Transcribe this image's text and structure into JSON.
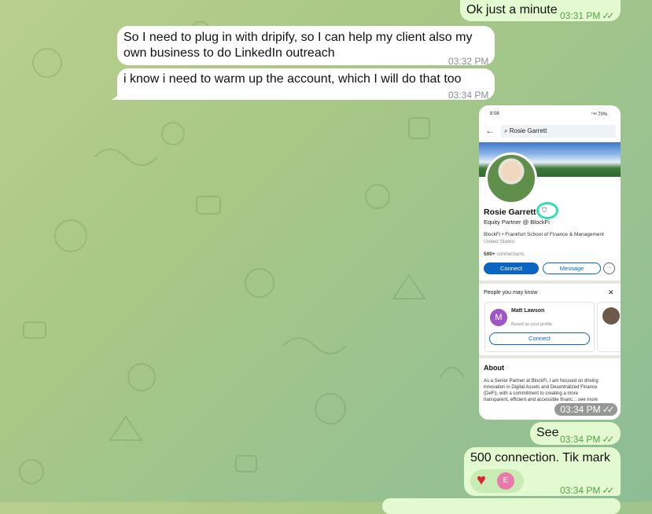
{
  "messages": [
    {
      "text": "Ok just a minute",
      "time": "03:31 PM",
      "ticks": "✓✓"
    },
    {
      "text_line1": "So I need to plug in with dripify, so I can help my client also my",
      "text_line2": "own business to do LinkedIn outreach",
      "time": "03:32 PM"
    },
    {
      "text": "i know i need to warm up the account, which I will do that too",
      "time": "03:34 PM"
    },
    {
      "image_time": "03:34 PM",
      "ticks": "✓✓"
    },
    {
      "text": "See",
      "time": "03:34 PM",
      "ticks": "✓✓"
    },
    {
      "text": "500 connection.  Tik mark",
      "time": "03:34 PM",
      "ticks": "✓✓",
      "reaction_emoji": "♥",
      "reaction_user": "E"
    }
  ],
  "screenshot": {
    "status_time": "8:08",
    "status_right": "⁺ᵃᵃ 70%",
    "search_value": "Rosie Garrett",
    "name": "Rosie Garrett",
    "headline": "Equity Partner @ BlockFi",
    "education": "BlockFi • Frankfurt School of Finance & Management",
    "location": "United States",
    "connections_count": "500+",
    "connections_label": "connections",
    "connect_label": "Connect",
    "message_label": "Message",
    "more_label": "···",
    "pymk_title": "People you may know",
    "pymk_close": "✕",
    "pymk_name": "Matt Lawson",
    "pymk_initial": "M",
    "pymk_reason": "Based on your profile",
    "pymk_connect": "Connect",
    "about_title": "About",
    "about_line1": "As a Senior Partner at BlockFi, I am focused on driving",
    "about_line2": "innovation in Digital Assets and Decentralized Finance",
    "about_line3": "(DeFi), with a commitment to creating a more",
    "about_line4": "transparent, efficient and accessible financ... see more"
  },
  "colors": {
    "incoming": "#ffffff",
    "outgoing": "#e3f9cf",
    "time_out": "#57a14a",
    "linkedin_blue": "#0a66c2"
  }
}
